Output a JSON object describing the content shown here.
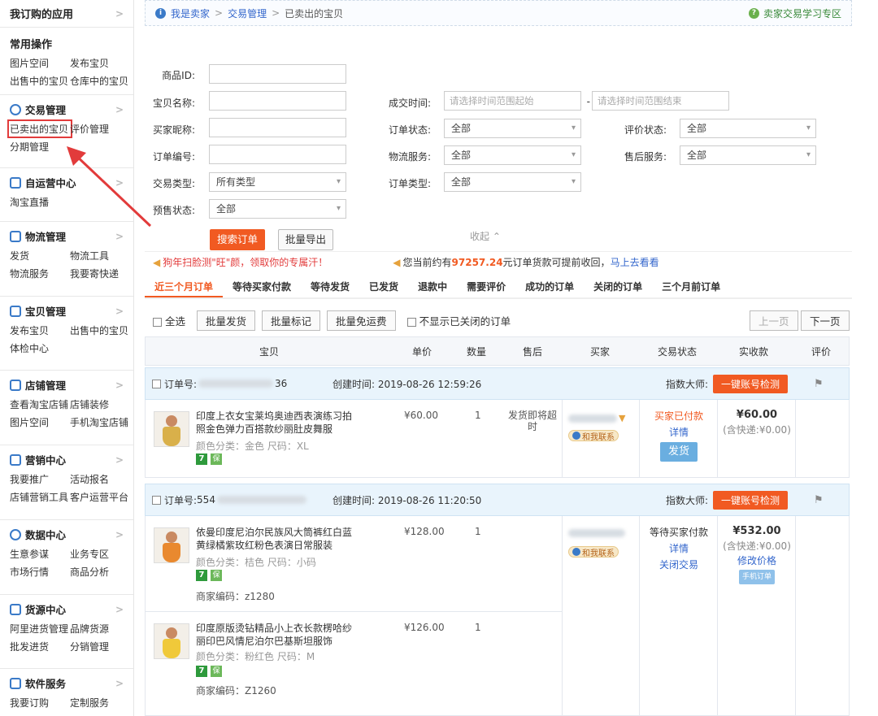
{
  "sidebar": {
    "top_title": "我订购的应用",
    "common_title": "常用操作",
    "common_links": [
      "图片空间",
      "发布宝贝",
      "出售中的宝贝",
      "仓库中的宝贝"
    ],
    "sections": [
      {
        "title": "交易管理",
        "icon": "trade-icon",
        "links": [
          "已卖出的宝贝",
          "评价管理",
          "分期管理"
        ]
      },
      {
        "title": "自运营中心",
        "icon": "chat-icon",
        "links": [
          "淘宝直播"
        ]
      },
      {
        "title": "物流管理",
        "icon": "logistics-icon",
        "links": [
          "发货",
          "物流工具",
          "物流服务",
          "我要寄快递"
        ]
      },
      {
        "title": "宝贝管理",
        "icon": "box-icon",
        "links": [
          "发布宝贝",
          "出售中的宝贝",
          "体检中心"
        ]
      },
      {
        "title": "店铺管理",
        "icon": "store-icon",
        "links": [
          "查看淘宝店铺",
          "店铺装修",
          "图片空间",
          "手机淘宝店铺"
        ]
      },
      {
        "title": "营销中心",
        "icon": "megaphone-icon",
        "links": [
          "我要推广",
          "活动报名",
          "店铺营销工具",
          "客户运营平台"
        ]
      },
      {
        "title": "数据中心",
        "icon": "dashboard-icon",
        "links": [
          "生意参谋",
          "业务专区",
          "市场行情",
          "商品分析"
        ]
      },
      {
        "title": "货源中心",
        "icon": "source-icon",
        "links": [
          "阿里进货管理",
          "品牌货源",
          "批发进货",
          "分销管理"
        ]
      },
      {
        "title": "软件服务",
        "icon": "apps-icon",
        "links": [
          "我要订购",
          "定制服务"
        ]
      }
    ]
  },
  "breadcrumb": {
    "items": [
      "我是卖家",
      "交易管理",
      "已卖出的宝贝"
    ],
    "help": "卖家交易学习专区"
  },
  "form": {
    "product_id": "商品ID:",
    "item_name": "宝贝名称:",
    "buyer_nick": "买家昵称:",
    "order_no": "订单编号:",
    "trade_type": "交易类型:",
    "trade_type_value": "所有类型",
    "presale_status": "预售状态:",
    "presale_value": "全部",
    "deal_time": "成交时间:",
    "time_start_ph": "请选择时间范围起始",
    "time_end_ph": "请选择时间范围结束",
    "dash": "-",
    "order_status": "订单状态:",
    "order_status_value": "全部",
    "logistics": "物流服务:",
    "logistics_value": "全部",
    "order_type": "订单类型:",
    "order_type_value": "全部",
    "review_status": "评价状态:",
    "review_value": "全部",
    "aftersale": "售后服务:",
    "aftersale_value": "全部",
    "search_btn": "搜索订单",
    "export_btn": "批量导出",
    "collapse": "收起"
  },
  "notice": {
    "promo": "狗年扫脸测\"旺\"颜，领取你的专属汗！",
    "pre": "您当前约有",
    "amount": "97257.24",
    "post": "元订单货款可提前收回，",
    "link": "马上去看看"
  },
  "tabs": [
    "近三个月订单",
    "等待买家付款",
    "等待发货",
    "已发货",
    "退款中",
    "需要评价",
    "成功的订单",
    "关闭的订单",
    "三个月前订单"
  ],
  "actions": {
    "select_all": "全选",
    "batch_ship": "批量发货",
    "batch_mark": "批量标记",
    "batch_free": "批量免运费",
    "hide_closed": "不显示已关闭的订单",
    "prev": "上一页",
    "next": "下一页"
  },
  "table_headers": [
    "宝贝",
    "单价",
    "数量",
    "售后",
    "买家",
    "交易状态",
    "实收款",
    "评价"
  ],
  "orders": [
    {
      "order_label": "订单号:",
      "order_tail": "36",
      "created": "创建时间: 2019-08-26 12:59:26",
      "master": "指数大师:",
      "check_btn": "一键账号检测",
      "contact": "和我联系",
      "status": "买家已付款",
      "detail": "详情",
      "ship_btn": "发货",
      "paid": "¥60.00",
      "paid_sub": "(含快递:¥0.00)",
      "items": [
        {
          "title": "印度上衣女宝莱坞奥迪西表演练习拍照金色弹力百搭款纱丽肚皮舞服",
          "price": "¥60.00",
          "qty": "1",
          "aftersale": "发货即将超时",
          "attr": "颜色分类：金色  尺码：XL",
          "code": ""
        }
      ]
    },
    {
      "order_label": "订单号:",
      "order_tail": "554",
      "created": "创建时间: 2019-08-26 11:20:50",
      "master": "指数大师:",
      "check_btn": "一键账号检测",
      "contact": "和我联系",
      "status": "等待买家付款",
      "detail": "详情",
      "close": "关闭交易",
      "paid": "¥532.00",
      "paid_sub": "(含快递:¥0.00)",
      "modify": "修改价格",
      "mobile_tag": "手机订单",
      "items": [
        {
          "title": "依曼印度尼泊尔民族风大筒裤红白蓝黄绿橘紫玫红粉色表演日常服装",
          "price": "¥128.00",
          "qty": "1",
          "aftersale": "",
          "attr": "颜色分类：桔色  尺码：小码",
          "code": "商家编码：z1280"
        },
        {
          "title": "印度原版烫钻精品小上衣长款楞哈纱丽印巴风情尼泊尔巴基斯坦服饰",
          "price": "¥126.00",
          "qty": "1",
          "aftersale": "",
          "attr": "颜色分类：粉红色  尺码：M",
          "code": "商家编码：Z1260"
        }
      ]
    }
  ],
  "colors": {
    "accent": "#f15a22",
    "link": "#3366cc",
    "highlight": "#e23b3b"
  }
}
